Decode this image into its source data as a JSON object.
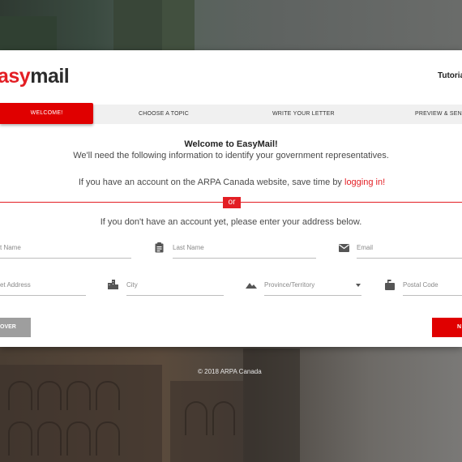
{
  "logo": {
    "part1": "asy",
    "part2": "mail"
  },
  "header": {
    "tutorial_label": "Tutoria"
  },
  "tabs": [
    {
      "label": "WELCOME!",
      "active": true
    },
    {
      "label": "CHOOSE A TOPIC",
      "active": false
    },
    {
      "label": "WRITE YOUR LETTER",
      "active": false
    },
    {
      "label": "PREVIEW & SEND!",
      "active": false
    }
  ],
  "intro": {
    "title": "Welcome to EasyMail!",
    "subtitle": "We'll need the following information to identify your government representatives.",
    "login_prefix": "If you have an account on the ARPA Canada website, save time by ",
    "login_link": "logging in!",
    "or_label": "or",
    "no_account": "If you don't have an account yet, please enter your address below."
  },
  "form": {
    "first_name_placeholder": "t Name",
    "last_name_placeholder": "Last Name",
    "email_placeholder": "Email",
    "street_placeholder": "et Address",
    "city_placeholder": "City",
    "province_placeholder": "Province/Territory",
    "postal_placeholder": "Postal Code"
  },
  "buttons": {
    "left_label": "OVER",
    "right_label": "N"
  },
  "footer": {
    "copyright": "© 2018 ARPA Canada"
  },
  "colors": {
    "accent": "#e31e24",
    "tab_active": "#e00000",
    "tab_bar": "#f0f0f0",
    "button_gray": "#9e9e9e"
  },
  "icons": [
    "clipboard-icon",
    "envelope-icon",
    "city-icon",
    "mountain-icon",
    "mailbox-icon",
    "dropdown-arrow-icon"
  ]
}
